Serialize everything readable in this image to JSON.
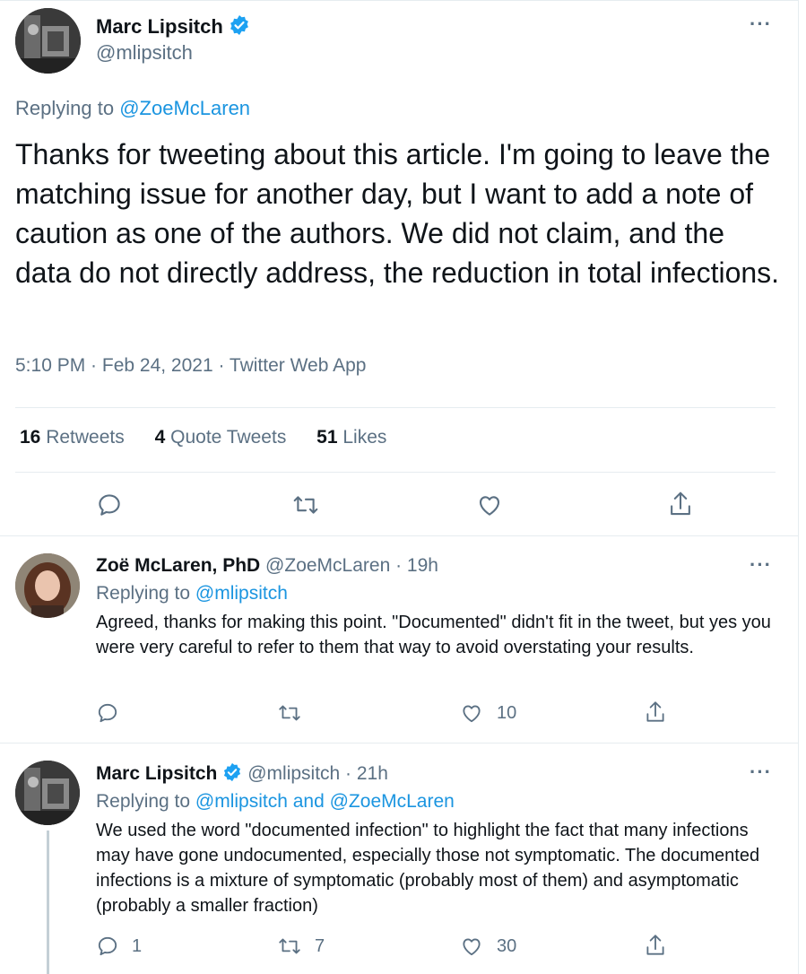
{
  "main_tweet": {
    "author": "Marc Lipsitch",
    "handle": "@mlipsitch",
    "replying_prefix": "Replying to",
    "replying_to": "@ZoeMcLaren",
    "text": "Thanks for tweeting about this article. I'm going to leave the matching issue for another day, but I want to add a note of caution as one of the authors. We did not claim, and the data do not directly address, the reduction in total infections.",
    "meta": "5:10 PM · Feb 24, 2021 · Twitter Web App",
    "retweets_count": "16",
    "retweets_label": "Retweets",
    "quote_count": "4",
    "quote_label": "Quote Tweets",
    "likes_count": "51",
    "likes_label": "Likes",
    "more": "···"
  },
  "replies": [
    {
      "author": "Zoë McLaren, PhD",
      "handle_time": "@ZoeMcLaren · 19h",
      "replying_prefix": "Replying to",
      "replying_to": "@mlipsitch",
      "text": "Agreed, thanks for making this point. \"Documented\" didn't fit in the tweet, but yes you were very careful to refer to them that way to avoid overstating your results.",
      "reply_count": "",
      "retweet_count": "",
      "like_count": "10",
      "more": "···"
    },
    {
      "author": "Marc Lipsitch",
      "handle_time": "@mlipsitch · 21h",
      "replying_prefix": "Replying to",
      "replying_to": "@mlipsitch and @ZoeMcLaren",
      "text": "We used the word \"documented infection\" to highlight the fact that many infections may have gone undocumented, especially those not symptomatic. The documented infections is a mixture of symptomatic (probably most of them) and asymptomatic (probably a smaller fraction)",
      "reply_count": "1",
      "retweet_count": "7",
      "like_count": "30",
      "more": "···"
    }
  ],
  "colors": {
    "accent": "#1b95e0",
    "secondary_text": "#5b7083",
    "border": "#e6ecf0",
    "verified": "#1da1f2"
  }
}
